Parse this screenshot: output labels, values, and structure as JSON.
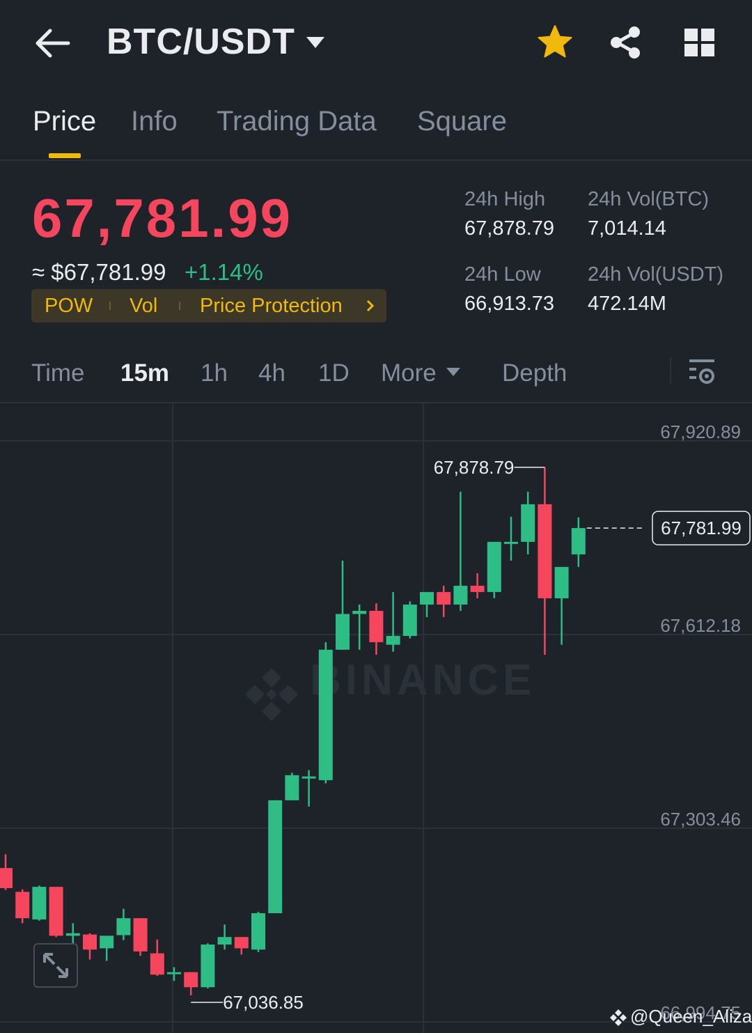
{
  "header": {
    "pair": "BTC/USDT",
    "icons": [
      "back-arrow-icon",
      "caret-down-icon",
      "star-icon",
      "share-icon",
      "grid-icon"
    ],
    "star_color": "#f0b90b"
  },
  "tabs": [
    {
      "label": "Price",
      "active": true
    },
    {
      "label": "Info",
      "active": false
    },
    {
      "label": "Trading Data",
      "active": false
    },
    {
      "label": "Square",
      "active": false
    }
  ],
  "ticker": {
    "last_price": "67,781.99",
    "usd_approx": "≈ $67,781.99",
    "change_pct": "+1.14%",
    "tags": [
      "POW",
      "Vol",
      "Price Protection"
    ],
    "stats": {
      "high_label": "24h High",
      "high": "67,878.79",
      "low_label": "24h Low",
      "low": "66,913.73",
      "vol_btc_label": "24h Vol(BTC)",
      "vol_btc": "7,014.14",
      "vol_usdt_label": "24h Vol(USDT)",
      "vol_usdt": "472.14M"
    },
    "colors": {
      "down": "#f6465d",
      "up": "#2ebd85",
      "accent": "#f0b90b"
    }
  },
  "intervals": {
    "items": [
      "Time",
      "15m",
      "1h",
      "4h",
      "1D",
      "More",
      "Depth"
    ],
    "active": "15m"
  },
  "chart_data": {
    "type": "candlestick",
    "watermark": "BINANCE",
    "y_axis_labels": [
      "67,920.89",
      "67,612.18",
      "67,303.46",
      "66,994.75"
    ],
    "ylim": [
      66994.75,
      67920.89
    ],
    "last_price_label": "67,781.99",
    "max_label": "67,878.79",
    "min_label": "67,036.85",
    "candles": [
      {
        "o": 67240,
        "h": 67262,
        "l": 67205,
        "c": 67208
      },
      {
        "o": 67202,
        "h": 67206,
        "l": 67152,
        "c": 67160
      },
      {
        "o": 67158,
        "h": 67212,
        "l": 67156,
        "c": 67210
      },
      {
        "o": 67210,
        "h": 67210,
        "l": 67130,
        "c": 67132
      },
      {
        "o": 67132,
        "h": 67152,
        "l": 67118,
        "c": 67136
      },
      {
        "o": 67134,
        "h": 67136,
        "l": 67094,
        "c": 67110
      },
      {
        "o": 67112,
        "h": 67128,
        "l": 67092,
        "c": 67132
      },
      {
        "o": 67133,
        "h": 67175,
        "l": 67125,
        "c": 67160
      },
      {
        "o": 67160,
        "h": 67160,
        "l": 67100,
        "c": 67107
      },
      {
        "o": 67104,
        "h": 67126,
        "l": 67068,
        "c": 67070
      },
      {
        "o": 67072,
        "h": 67082,
        "l": 67060,
        "c": 67074
      },
      {
        "o": 67074,
        "h": 67074,
        "l": 67037,
        "c": 67050
      },
      {
        "o": 67050,
        "h": 67120,
        "l": 67048,
        "c": 67118
      },
      {
        "o": 67118,
        "h": 67150,
        "l": 67110,
        "c": 67130
      },
      {
        "o": 67130,
        "h": 67130,
        "l": 67102,
        "c": 67112
      },
      {
        "o": 67110,
        "h": 67170,
        "l": 67106,
        "c": 67168
      },
      {
        "o": 67168,
        "h": 67348,
        "l": 67168,
        "c": 67348
      },
      {
        "o": 67348,
        "h": 67392,
        "l": 67348,
        "c": 67388
      },
      {
        "o": 67386,
        "h": 67396,
        "l": 67338,
        "c": 67386
      },
      {
        "o": 67380,
        "h": 67600,
        "l": 67375,
        "c": 67588
      },
      {
        "o": 67588,
        "h": 67730,
        "l": 67588,
        "c": 67645
      },
      {
        "o": 67645,
        "h": 67660,
        "l": 67588,
        "c": 67650
      },
      {
        "o": 67650,
        "h": 67662,
        "l": 67580,
        "c": 67600
      },
      {
        "o": 67596,
        "h": 67680,
        "l": 67585,
        "c": 67610
      },
      {
        "o": 67610,
        "h": 67665,
        "l": 67606,
        "c": 67660
      },
      {
        "o": 67660,
        "h": 67675,
        "l": 67640,
        "c": 67680
      },
      {
        "o": 67680,
        "h": 67690,
        "l": 67640,
        "c": 67660
      },
      {
        "o": 67660,
        "h": 67840,
        "l": 67650,
        "c": 67690
      },
      {
        "o": 67690,
        "h": 67710,
        "l": 67670,
        "c": 67680
      },
      {
        "o": 67680,
        "h": 67750,
        "l": 67670,
        "c": 67760
      },
      {
        "o": 67760,
        "h": 67800,
        "l": 67730,
        "c": 67760
      },
      {
        "o": 67760,
        "h": 67840,
        "l": 67740,
        "c": 67820
      },
      {
        "o": 67820,
        "h": 67878.79,
        "l": 67580,
        "c": 67670
      },
      {
        "o": 67670,
        "h": 67700,
        "l": 67596,
        "c": 67720
      },
      {
        "o": 67740,
        "h": 67799,
        "l": 67720,
        "c": 67781.99
      }
    ],
    "grid": true
  },
  "footer": {
    "watermark_text": "@Queen_Aliza"
  }
}
